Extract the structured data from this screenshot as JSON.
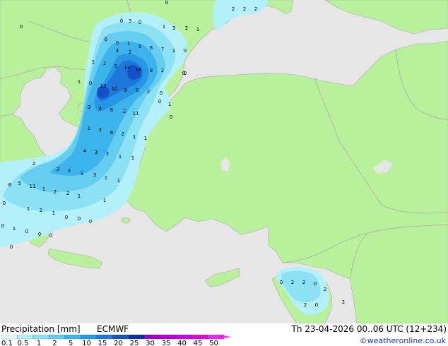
{
  "legend": {
    "title": "Precipitation [mm]",
    "model": "ECMWF",
    "validity": "Th 23-04-2026 00..06 UTC (12+234)",
    "credit": "©weatheronline.co.uk",
    "scale_labels": [
      "0.1",
      "0.5",
      "1",
      "2",
      "5",
      "10",
      "15",
      "20",
      "25",
      "30",
      "35",
      "40",
      "45",
      "50"
    ],
    "scale_colors": [
      "#e6fcff",
      "#b4f0fa",
      "#8ce1f5",
      "#64cdf0",
      "#3cb4eb",
      "#2896e6",
      "#1e78dc",
      "#1450c8",
      "#0a28b4",
      "#9600c8",
      "#b400d2",
      "#d200dc",
      "#e600e6",
      "#f028f0"
    ]
  },
  "colors": {
    "land": "#b9f09b",
    "sea": "#e6e6e6",
    "border": "#aaaaaa"
  },
  "precip_values": [
    "0",
    "3",
    "0",
    "1",
    "3",
    "2",
    "1",
    "6",
    "0",
    "1",
    "4",
    "2",
    "5",
    "6",
    "7",
    "1",
    "0",
    "1",
    "2",
    "5",
    "12",
    "18",
    "8",
    "2",
    "0",
    "1",
    "10",
    "13",
    "0",
    "8",
    "9",
    "2",
    "0",
    "3",
    "4",
    "6",
    "2",
    "11",
    "0",
    "1",
    "2",
    "6",
    "2",
    "1",
    "1",
    "4",
    "3",
    "2",
    "1",
    "1",
    "2",
    "3",
    "2",
    "1",
    "3",
    "5",
    "1",
    "1",
    "6",
    "11",
    "1",
    "2",
    "2",
    "1",
    "1",
    "0",
    "1",
    "2",
    "1",
    "0",
    "0",
    "0",
    "0",
    "1",
    "0",
    "0",
    "0",
    "0",
    "0",
    "0",
    "2",
    "2",
    "2",
    "0",
    "2",
    "0",
    "2",
    "0",
    "2",
    "0",
    "2",
    "2",
    "0",
    "1"
  ]
}
